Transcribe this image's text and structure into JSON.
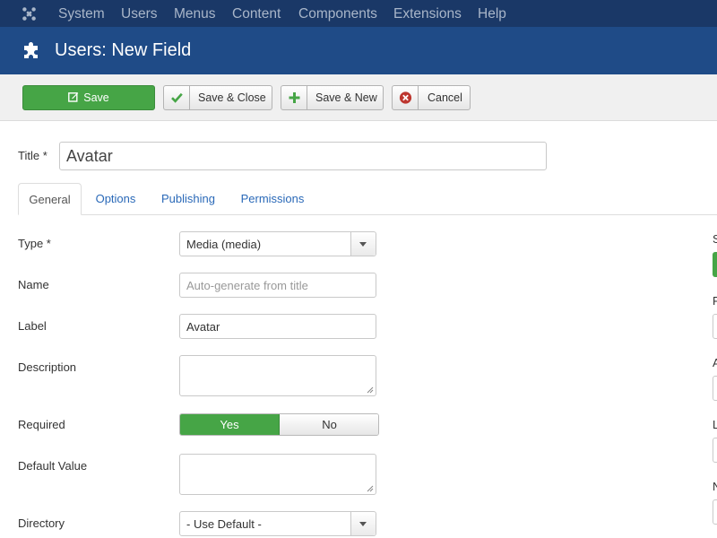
{
  "topnav": {
    "logo_icon": "joomla-logo-icon",
    "items": [
      "System",
      "Users",
      "Menus",
      "Content",
      "Components",
      "Extensions",
      "Help"
    ]
  },
  "header": {
    "icon": "puzzle-plugin-icon",
    "title": "Users: New Field"
  },
  "toolbar": {
    "save_label": "Save",
    "save_close_label": "Save & Close",
    "save_new_label": "Save & New",
    "cancel_label": "Cancel"
  },
  "form": {
    "title_label": "Title *",
    "title_value": "Avatar",
    "tabs": [
      "General",
      "Options",
      "Publishing",
      "Permissions"
    ],
    "active_tab": "General",
    "type_label": "Type *",
    "type_value": "Media (media)",
    "name_label": "Name",
    "name_placeholder": "Auto-generate from title",
    "label_label": "Label",
    "label_value": "Avatar",
    "description_label": "Description",
    "required_label": "Required",
    "required_yes": "Yes",
    "required_no": "No",
    "required_selected": "Yes",
    "default_value_label": "Default Value",
    "directory_label": "Directory",
    "directory_value": "- Use Default -"
  },
  "right_column": {
    "letters": [
      "S",
      "F",
      "A",
      "L",
      "N"
    ]
  },
  "colors": {
    "topnav_bg": "#1a3867",
    "header_bg": "#1f4b87",
    "success_green": "#46a546",
    "link_blue": "#2a69b8",
    "cancel_red": "#bd362f"
  }
}
